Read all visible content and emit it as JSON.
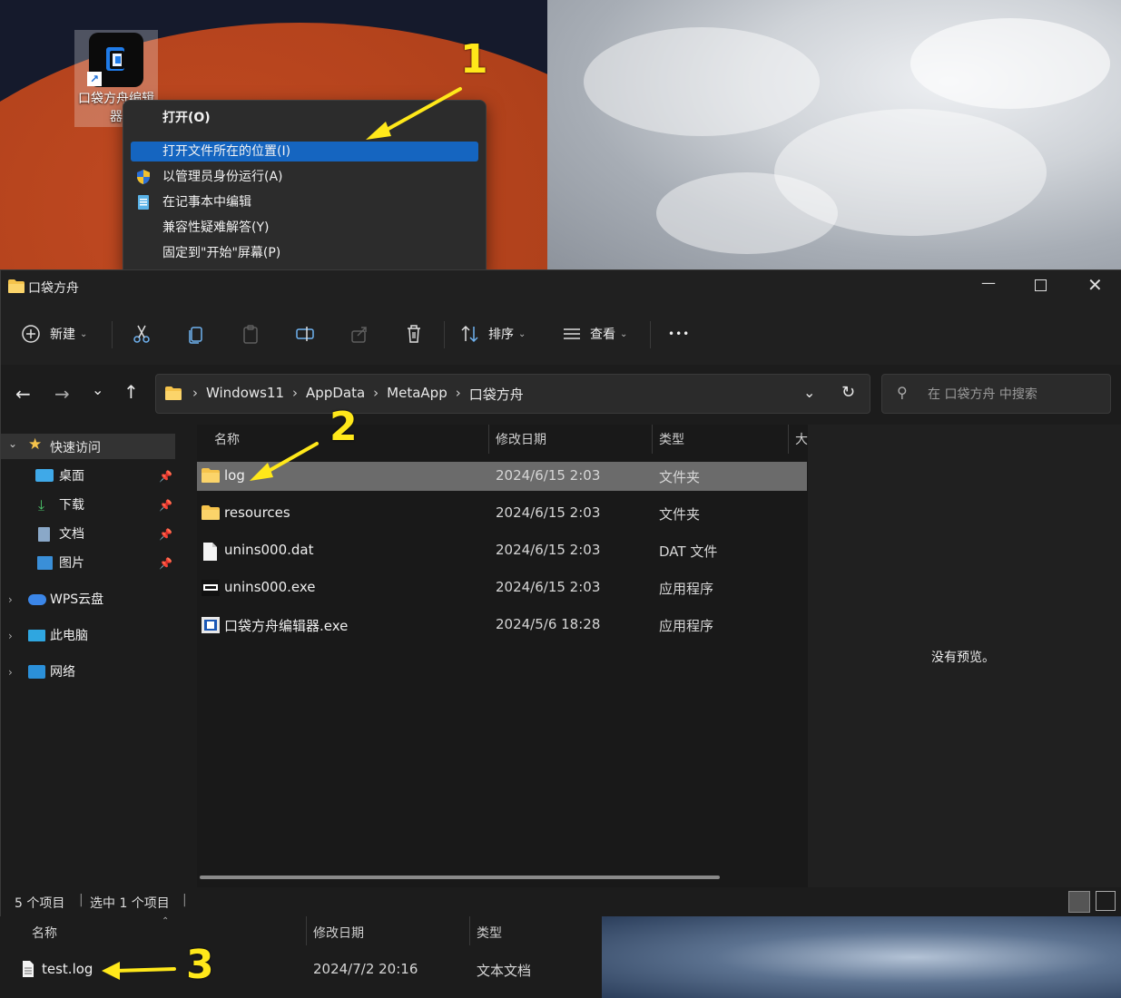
{
  "desktop_icon": {
    "label": "口袋方舟编辑器"
  },
  "context_menu": {
    "items": [
      {
        "label": "打开(O)",
        "bold": true
      },
      {
        "label": "打开文件所在的位置(I)",
        "highlighted": true
      },
      {
        "label": "以管理员身份运行(A)",
        "icon": "shield-icon"
      },
      {
        "label": "在记事本中编辑",
        "icon": "notepad-icon"
      },
      {
        "label": "兼容性疑难解答(Y)"
      },
      {
        "label": "固定到\"开始\"屏幕(P)"
      }
    ]
  },
  "annotations": {
    "step1": "1",
    "step2": "2",
    "step3": "3",
    "color": "#ffe81a"
  },
  "window": {
    "title": "口袋方舟",
    "toolbar": {
      "new_label": "新建",
      "sort_label": "排序",
      "view_label": "查看",
      "more_label": "•••"
    },
    "breadcrumb": [
      "Windows11",
      "AppData",
      "MetaApp",
      "口袋方舟"
    ],
    "search_placeholder": "在 口袋方舟 中搜索",
    "nav": {
      "quick_access": "快速访问",
      "pinned": [
        "桌面",
        "下载",
        "文档",
        "图片"
      ],
      "wps": "WPS云盘",
      "this_pc": "此电脑",
      "network": "网络"
    },
    "columns": {
      "name": "名称",
      "date": "修改日期",
      "type": "类型",
      "size": "大"
    },
    "files": [
      {
        "name": "log",
        "date": "2024/6/15 2:03",
        "type": "文件夹",
        "icon": "folder-icon",
        "selected": true
      },
      {
        "name": "resources",
        "date": "2024/6/15 2:03",
        "type": "文件夹",
        "icon": "folder-icon"
      },
      {
        "name": "unins000.dat",
        "date": "2024/6/15 2:03",
        "type": "DAT 文件",
        "icon": "file-icon"
      },
      {
        "name": "unins000.exe",
        "date": "2024/6/15 2:03",
        "type": "应用程序",
        "icon": "exe-icon"
      },
      {
        "name": "口袋方舟编辑器.exe",
        "date": "2024/5/6 18:28",
        "type": "应用程序",
        "icon": "app-icon"
      }
    ],
    "preview_text": "没有预览。",
    "status": {
      "count": "5 个项目",
      "selected": "选中 1 个项目"
    }
  },
  "bottom_list": {
    "columns": {
      "name": "名称",
      "date": "修改日期",
      "type": "类型"
    },
    "file": {
      "name": "test.log",
      "date": "2024/7/2 20:16",
      "type": "文本文档"
    }
  }
}
